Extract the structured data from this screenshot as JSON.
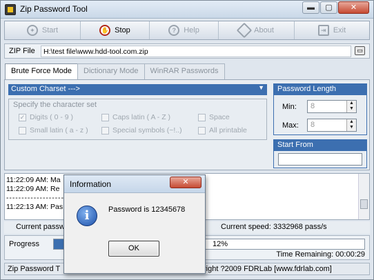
{
  "window": {
    "title": "Zip Password Tool",
    "controls": {
      "minimize": "▬",
      "maximize": "▢",
      "close": "✕"
    }
  },
  "toolbar": {
    "start": "Start",
    "stop": "Stop",
    "help": "Help",
    "about": "About",
    "exit": "Exit"
  },
  "zip": {
    "label": "ZIP File",
    "path": "H:\\test file\\www.hdd-tool.com.zip"
  },
  "tabs": [
    "Brute Force Mode",
    "Dictionary Mode",
    "WinRAR Passwords"
  ],
  "charset": {
    "selected": "Custom Charset  --->",
    "legend": "Specify the character set",
    "options": {
      "digits": "Digits ( 0 - 9 )",
      "caps": "Caps latin ( A - Z )",
      "space": "Space",
      "small": "Small latin ( a - z )",
      "special": "Special symbols (~!..)",
      "printable": "All printable"
    }
  },
  "length": {
    "header": "Password Length",
    "min_label": "Min:",
    "min": "8",
    "max_label": "Max:",
    "max": "8"
  },
  "start_from": {
    "header": "Start From",
    "value": ""
  },
  "log": [
    "11:22:09 AM: Ma",
    "11:22:09 AM: Re",
    "- - - - - - - - - - - - - - - - - - - - - - - - - - - - - - - - - - - - - - - - - - - - - - - - - - - - - - - - - - - - - - - -",
    "11:22:13 AM: Pas"
  ],
  "status": {
    "current_password_label": "Current passw",
    "current_speed_label": "Current speed:",
    "speed": "3332968 pass/s"
  },
  "progress": {
    "label": "Progress",
    "percent_text": "12%",
    "fraction": 0.12,
    "time_remaining": "Time Remaining: 00:00:29"
  },
  "statusbar": {
    "left": "Zip Password T",
    "right": "right ?2009 FDRLab [www.fdrlab.com]"
  },
  "dialog": {
    "title": "Information",
    "close": "✕",
    "message": "Password is 12345678",
    "ok": "OK"
  },
  "colors": {
    "accent": "#3c6fb0",
    "close_red": "#c64a32",
    "stop_icon": "#b2271a"
  }
}
